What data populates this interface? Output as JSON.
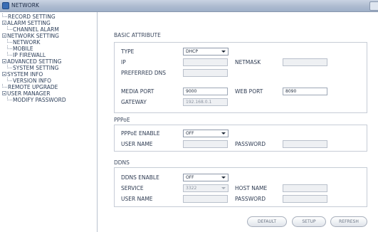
{
  "window": {
    "title": "NETWORK"
  },
  "sidebar": {
    "items": [
      {
        "label": "RECORD SETTING"
      },
      {
        "label": "ALARM SETTING"
      },
      {
        "label": "CHANNEL ALARM"
      },
      {
        "label": "NETWORK SETTING"
      },
      {
        "label": "NETWORK"
      },
      {
        "label": "MOBILE"
      },
      {
        "label": "IP FIREWALL"
      },
      {
        "label": "ADVANCED SETTING"
      },
      {
        "label": "SYSTEM SETTING"
      },
      {
        "label": "SYSTEM INFO"
      },
      {
        "label": "VERSION INFO"
      },
      {
        "label": "REMOTE UPGRADE"
      },
      {
        "label": "USER MANAGER"
      },
      {
        "label": "MODIFY PASSWORD"
      }
    ]
  },
  "basic": {
    "section_title": "BASIC ATTRIBUTE",
    "type_label": "TYPE",
    "type_value": "DHCP",
    "ip_label": "IP",
    "ip_value": "",
    "netmask_label": "NETMASK",
    "netmask_value": "",
    "dns_label": "PREFERRED DNS",
    "dns_value": "",
    "media_port_label": "MEDIA PORT",
    "media_port_value": "9000",
    "web_port_label": "WEB PORT",
    "web_port_value": "8090",
    "gateway_label": "GATEWAY",
    "gateway_value": "192.168.0.1"
  },
  "pppoe": {
    "section_title": "PPPoE",
    "enable_label": "PPPoE ENABLE",
    "enable_value": "OFF",
    "user_label": "USER NAME",
    "user_value": "",
    "password_label": "PASSWORD",
    "password_value": ""
  },
  "ddns": {
    "section_title": "DDNS",
    "enable_label": "DDNS ENABLE",
    "enable_value": "OFF",
    "service_label": "SERVICE",
    "service_value": "3322",
    "host_label": "HOST NAME",
    "host_value": "",
    "user_label": "USER NAME",
    "user_value": "",
    "password_label": "PASSWORD",
    "password_value": ""
  },
  "buttons": {
    "default": "DEFAULT",
    "setup": "SETUP",
    "refresh": "REFRESH"
  }
}
